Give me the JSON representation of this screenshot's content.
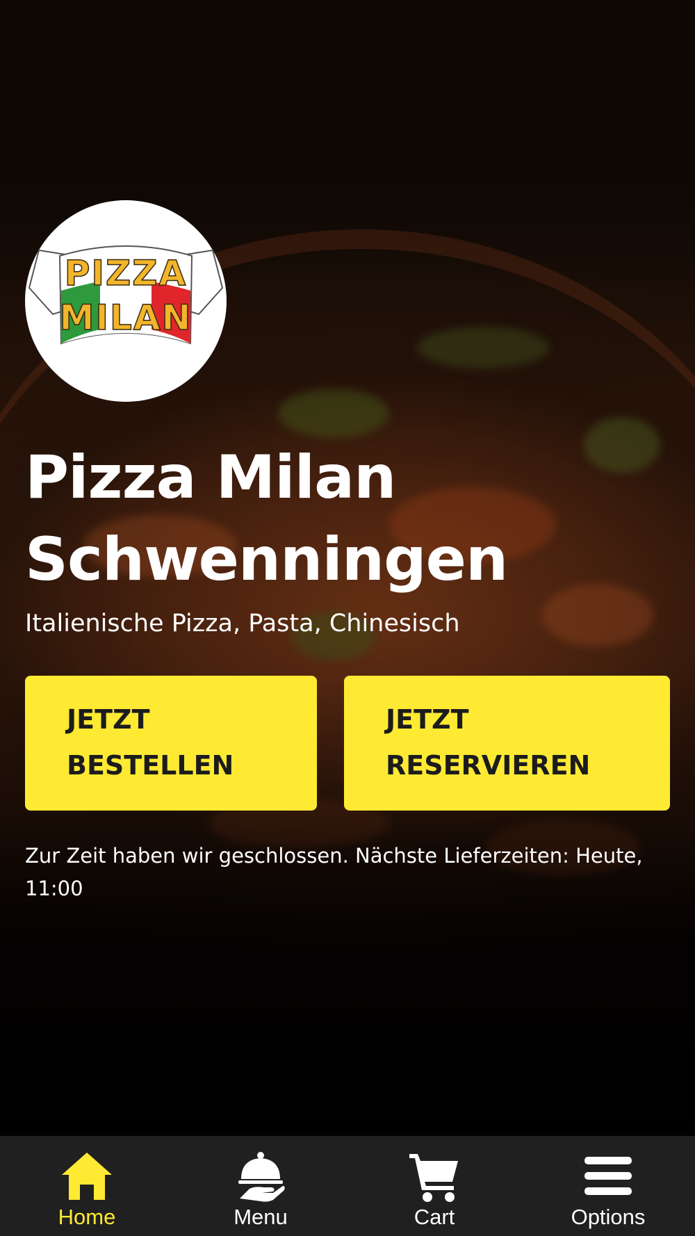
{
  "restaurant": {
    "logo": {
      "line1": "PIZZA",
      "line2": "MILAN"
    },
    "title_line1": "Pizza Milan",
    "title_line2": "Schwenningen",
    "cuisine": "Italienische Pizza, Pasta, Chinesisch"
  },
  "actions": {
    "order": {
      "line1": "JETZT",
      "line2": "BESTELLEN"
    },
    "reserve": {
      "line1": "JETZT",
      "line2": "RESERVIEREN"
    }
  },
  "status_message": "Zur Zeit haben wir geschlossen. Nächste Lieferzeiten: Heute, 11:00",
  "bottom_nav": {
    "items": [
      {
        "label": "Home",
        "icon": "home-icon",
        "active": true
      },
      {
        "label": "Menu",
        "icon": "cloche-icon",
        "active": false
      },
      {
        "label": "Cart",
        "icon": "cart-icon",
        "active": false
      },
      {
        "label": "Options",
        "icon": "hamburger-icon",
        "active": false
      }
    ]
  },
  "colors": {
    "accent": "#ffea33",
    "nav_background": "#202020",
    "button_text": "#1c1c1c",
    "logo_green": "#2e9a3d",
    "logo_red": "#e0262b",
    "logo_letters": "#f2b52c"
  }
}
